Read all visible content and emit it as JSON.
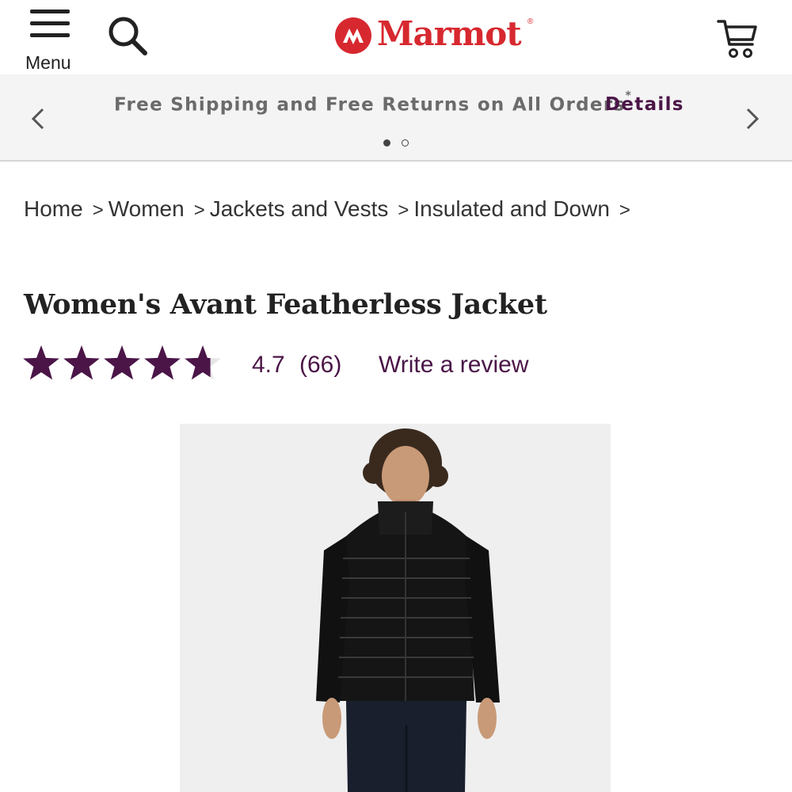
{
  "header": {
    "menu_label": "Menu",
    "brand": "Marmot",
    "brand_mark": "®",
    "icons": [
      "hamburger-menu-icon",
      "search-icon",
      "marmot-logo",
      "cart-icon"
    ]
  },
  "promo": {
    "text": "Free Shipping and Free Returns on All Orders",
    "asterisk": "*",
    "details_label": "Details",
    "slide_count": 2,
    "active_slide": 1
  },
  "breadcrumb": {
    "items": [
      "Home",
      "Women",
      "Jackets and Vests",
      "Insulated and Down"
    ],
    "separator": ">"
  },
  "product": {
    "title": "Women's Avant Featherless Jacket",
    "rating": {
      "value": "4.7",
      "count": "(66)",
      "stars_filled": 4.7,
      "stars_total": 5
    },
    "write_review_label": "Write a review"
  },
  "colors": {
    "brand_red": "#d7282f",
    "accent_purple": "#4b1548",
    "banner_bg": "#f4f4f4"
  }
}
